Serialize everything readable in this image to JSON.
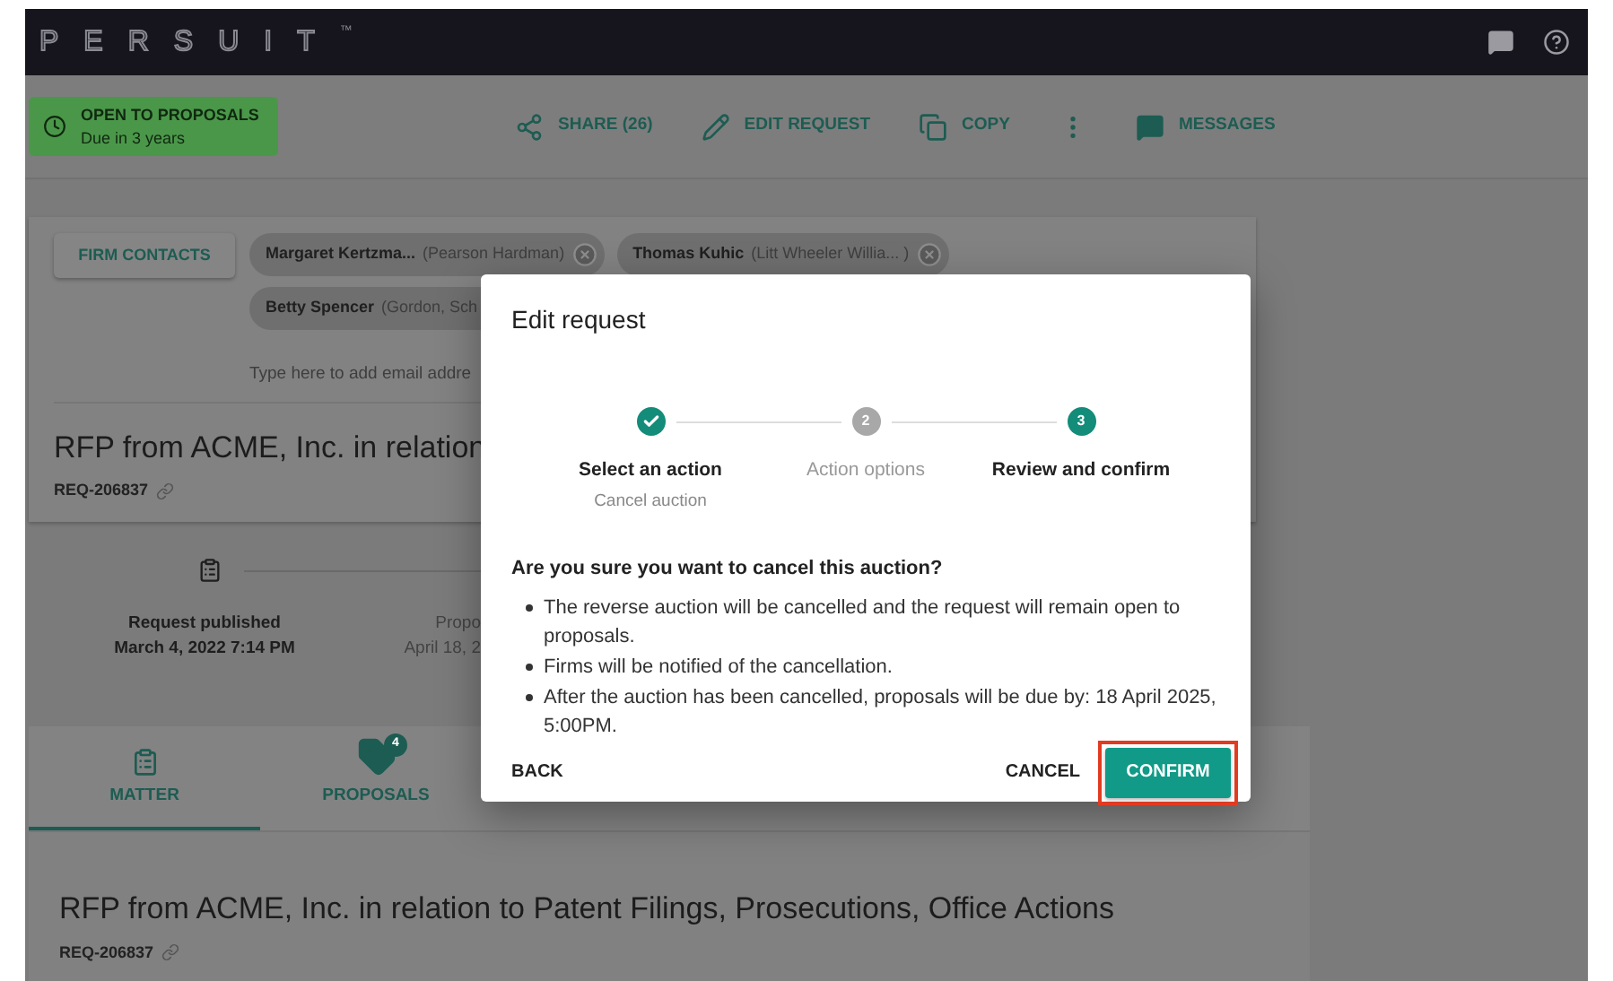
{
  "app": {
    "logo": "PERSUIT",
    "trademark": "™"
  },
  "status_chip": {
    "title": "OPEN TO PROPOSALS",
    "subtitle": "Due in 3 years"
  },
  "toolbar": [
    {
      "kind": "share",
      "label": "SHARE (26)"
    },
    {
      "kind": "edit",
      "label": "EDIT REQUEST"
    },
    {
      "kind": "copy",
      "label": "COPY"
    },
    {
      "kind": "more"
    },
    {
      "kind": "messages",
      "label": "MESSAGES"
    }
  ],
  "contacts": {
    "button": "FIRM CONTACTS",
    "chips": [
      {
        "name": "Margaret Kertzma...",
        "firm": "(Pearson Hardman)",
        "removable": true
      },
      {
        "name": "Thomas Kuhic",
        "firm": "(Litt Wheeler Willia... )",
        "removable": true
      },
      {
        "name": "Betty Spencer",
        "firm": "(Gordon, Sch"
      }
    ],
    "placeholder": "Type here to add email addre"
  },
  "request": {
    "title": "RFP from ACME, Inc. in relation",
    "id": "REQ-206837"
  },
  "timeline": [
    {
      "title": "Request published",
      "date": "March 4, 2022 7:14 PM"
    },
    {
      "title": "Propo",
      "date": "April 18, 2"
    }
  ],
  "tabs": [
    {
      "kind": "matter",
      "label": "MATTER",
      "selected": true
    },
    {
      "kind": "proposals",
      "label": "PROPOSALS",
      "selected": false,
      "badge": "4"
    }
  ],
  "matter": {
    "title": "RFP from ACME, Inc. in relation to Patent Filings, Prosecutions, Office Actions",
    "id": "REQ-206837"
  },
  "dialog": {
    "title": "Edit request",
    "steps": [
      {
        "label": "Select an action",
        "sublabel": "Cancel auction",
        "completed": true,
        "active": false
      },
      {
        "number": "2",
        "label": "Action options",
        "completed": false,
        "active": false
      },
      {
        "number": "3",
        "label": "Review and confirm",
        "completed": false,
        "active": true
      }
    ],
    "question": "Are you sure you want to cancel this auction?",
    "bullets": [
      "The reverse auction will be cancelled and the request will remain open to proposals.",
      "Firms will be notified of the cancellation.",
      "After the auction has been cancelled, proposals will be due by: 18 April 2025, 5:00PM."
    ],
    "back": "BACK",
    "cancel": "CANCEL",
    "confirm": {
      "label": "CONFIRM",
      "highlighted": true
    }
  }
}
